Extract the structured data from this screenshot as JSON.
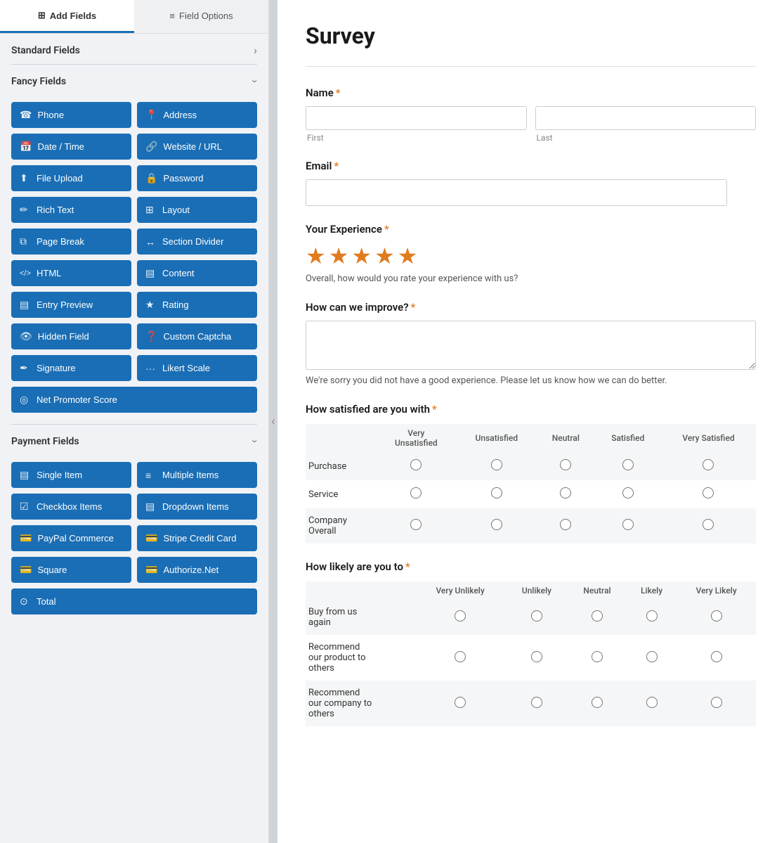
{
  "tabs": {
    "add_fields": "Add Fields",
    "field_options": "Field Options"
  },
  "sidebar": {
    "standard_fields_label": "Standard Fields",
    "fancy_fields_label": "Fancy Fields",
    "payment_fields_label": "Payment Fields",
    "fancy_fields": [
      {
        "id": "phone",
        "label": "Phone",
        "icon": "☎"
      },
      {
        "id": "address",
        "label": "Address",
        "icon": "📍"
      },
      {
        "id": "date_time",
        "label": "Date / Time",
        "icon": "📅"
      },
      {
        "id": "website_url",
        "label": "Website / URL",
        "icon": "🔗"
      },
      {
        "id": "file_upload",
        "label": "File Upload",
        "icon": "⬆"
      },
      {
        "id": "password",
        "label": "Password",
        "icon": "🔒"
      },
      {
        "id": "rich_text",
        "label": "Rich Text",
        "icon": "✏"
      },
      {
        "id": "layout",
        "label": "Layout",
        "icon": "⊞"
      },
      {
        "id": "page_break",
        "label": "Page Break",
        "icon": "⧉"
      },
      {
        "id": "section_divider",
        "label": "Section Divider",
        "icon": "↔"
      },
      {
        "id": "html",
        "label": "HTML",
        "icon": "</>"
      },
      {
        "id": "content",
        "label": "Content",
        "icon": "▤"
      },
      {
        "id": "entry_preview",
        "label": "Entry Preview",
        "icon": "▤"
      },
      {
        "id": "rating",
        "label": "Rating",
        "icon": "★"
      },
      {
        "id": "hidden_field",
        "label": "Hidden Field",
        "icon": "👁"
      },
      {
        "id": "custom_captcha",
        "label": "Custom Captcha",
        "icon": "❓"
      },
      {
        "id": "signature",
        "label": "Signature",
        "icon": "✒"
      },
      {
        "id": "likert_scale",
        "label": "Likert Scale",
        "icon": "···"
      },
      {
        "id": "net_promoter_score",
        "label": "Net Promoter Score",
        "icon": "◎"
      }
    ],
    "payment_fields": [
      {
        "id": "single_item",
        "label": "Single Item",
        "icon": "▤"
      },
      {
        "id": "multiple_items",
        "label": "Multiple Items",
        "icon": "≡"
      },
      {
        "id": "checkbox_items",
        "label": "Checkbox Items",
        "icon": "☑"
      },
      {
        "id": "dropdown_items",
        "label": "Dropdown Items",
        "icon": "▤"
      },
      {
        "id": "paypal_commerce",
        "label": "PayPal Commerce",
        "icon": "💳"
      },
      {
        "id": "stripe_credit_card",
        "label": "Stripe Credit Card",
        "icon": "💳"
      },
      {
        "id": "square",
        "label": "Square",
        "icon": "💳"
      },
      {
        "id": "authorize_net",
        "label": "Authorize.Net",
        "icon": "💳"
      },
      {
        "id": "total",
        "label": "Total",
        "icon": "⊙"
      }
    ]
  },
  "form": {
    "title": "Survey",
    "name_label": "Name",
    "name_first_placeholder": "",
    "name_last_placeholder": "",
    "name_first_sublabel": "First",
    "name_last_sublabel": "Last",
    "email_label": "Email",
    "experience_label": "Your Experience",
    "experience_stars": 5,
    "experience_hint": "Overall, how would you rate your experience with us?",
    "improve_label": "How can we improve?",
    "improve_hint": "We're sorry you did not have a good experience. Please let us know how we can do better.",
    "satisfied_label": "How satisfied are you with",
    "satisfied_columns": [
      "Very\nUnsatisfied",
      "Unsatisfied",
      "Neutral",
      "Satisfied",
      "Very Satisfied"
    ],
    "satisfied_rows": [
      "Purchase",
      "Service",
      "Company\nOverall"
    ],
    "likely_label": "How likely are you to",
    "likely_columns": [
      "Very Unlikely",
      "Unlikely",
      "Neutral",
      "Likely",
      "Very Likely"
    ],
    "likely_rows": [
      "Buy from us\nagain",
      "Recommend\nour product to\nothers",
      "Recommend\nour company to\nothers"
    ]
  },
  "icons": {
    "grid": "⊞",
    "sliders": "≡"
  }
}
